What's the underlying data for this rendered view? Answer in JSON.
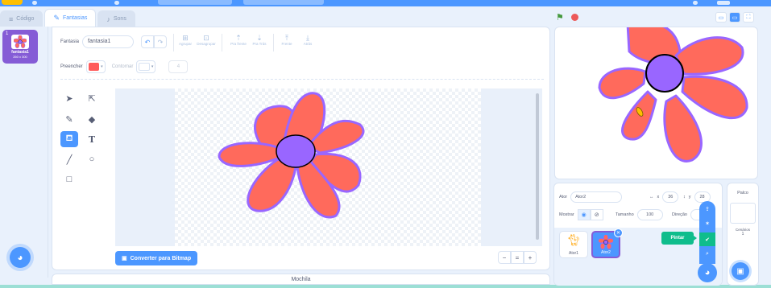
{
  "tabs": [
    {
      "label": "Código",
      "icon": "code-icon"
    },
    {
      "label": "Fantasias",
      "icon": "brush-icon"
    },
    {
      "label": "Sons",
      "icon": "speaker-icon"
    }
  ],
  "costumes": [
    {
      "number": "1",
      "name": "fantasia1",
      "size": "260 x 300"
    }
  ],
  "editor": {
    "costume_label": "Fantasia",
    "costume_name": "fantasia1",
    "operations": [
      "Agrupar",
      "Desagrupar",
      "Pra frente",
      "Pra Trás",
      "Frente",
      "Atrás"
    ],
    "fill_label": "Preencher",
    "fill_color": "#ff5c5c",
    "outline_label": "Contornar",
    "outline_color": "#ffffff",
    "outline_width": "4",
    "convert_label": "Converter para Bitmap",
    "zoom": [
      "−",
      "=",
      "+"
    ]
  },
  "backpack_label": "Mochila",
  "sprite_info": {
    "sprite_label": "Ator",
    "sprite_name": "Ator2",
    "x_label": "x",
    "x_value": "36",
    "y_label": "y",
    "y_value": "28",
    "show_label": "Mostrar",
    "size_label": "Tamanho",
    "size_value": "100",
    "direction_label": "Direção",
    "direction_value": ""
  },
  "sprites": [
    {
      "name": "Ator1"
    },
    {
      "name": "Ator2"
    }
  ],
  "stage_panel": {
    "title": "Palco",
    "backdrops_label": "Cenários",
    "backdrops_count": "1"
  },
  "tooltip_paint": "Pintar",
  "colors": {
    "accent": "#4c97ff",
    "petal_fill": "#ff6a5c",
    "petal_outline": "#9966ff",
    "center_fill": "#9966ff",
    "paint_green": "#0fbd8c"
  }
}
